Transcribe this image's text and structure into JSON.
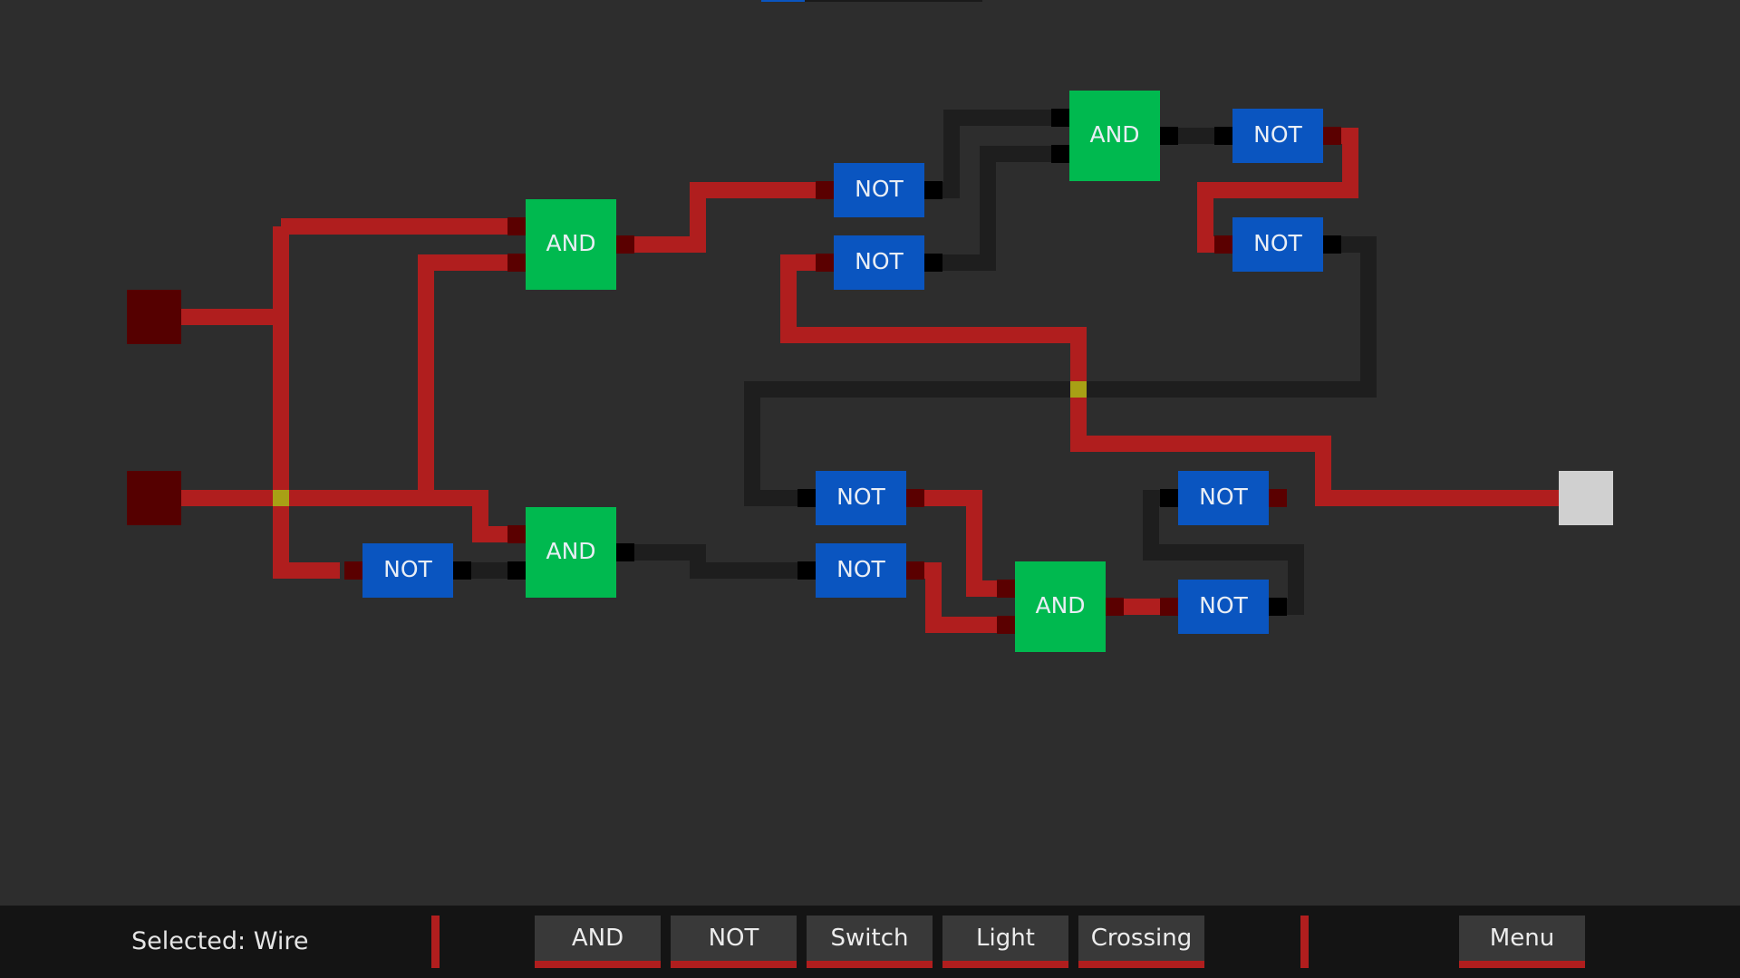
{
  "gates": {
    "and_label": "AND",
    "not_label": "NOT"
  },
  "status": {
    "selected_text": "Selected: Wire"
  },
  "toolbar": {
    "buttons": [
      "AND",
      "NOT",
      "Switch",
      "Light",
      "Crossing"
    ],
    "menu_label": "Menu"
  },
  "colors": {
    "background": "#2d2d2d",
    "wire_on": "#b01e1e",
    "wire_off": "#1e1e1e",
    "and_gate": "#00b94f",
    "not_gate": "#0a55c0",
    "switch_off": "#550000",
    "light_on": "#d0d0d0",
    "crossing": "#a8a015",
    "toolbar_bg": "#141414"
  }
}
